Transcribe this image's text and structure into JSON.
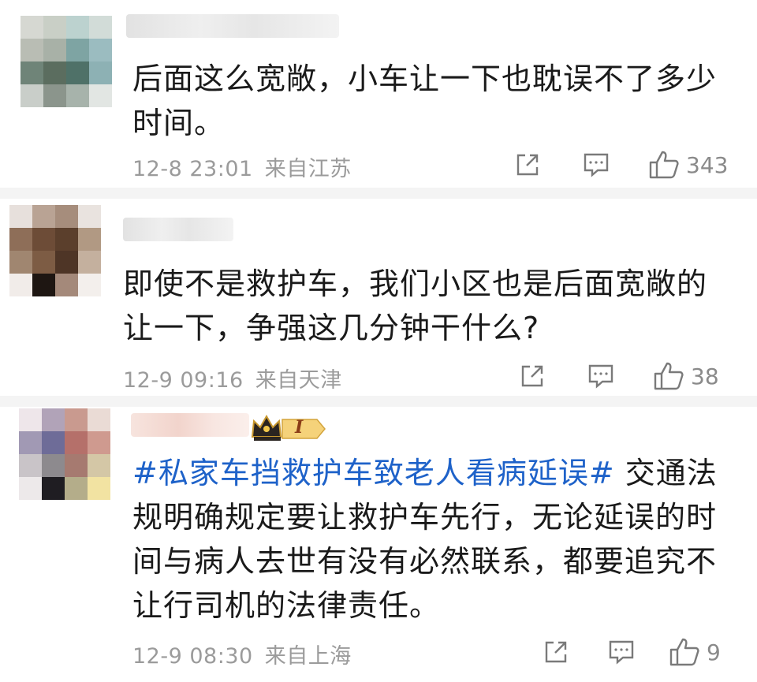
{
  "comments": [
    {
      "text": "后面这么宽敞，小车让一下也耽误不了多少时间。",
      "time": "12-8 23:01",
      "location": "来自江苏",
      "likes": "343"
    },
    {
      "text": "即使不是救护车，我们小区也是后面宽敞的让一下，争强这几分钟干什么?",
      "time": "12-9 09:16",
      "location": "来自天津",
      "likes": "38"
    },
    {
      "topic": "#私家车挡救护车致老人看病延误#",
      "text": " 交通法规明确规定要让救护车先行，无论延误的时间与病人去世有没有必然联系，都要追究不让行司机的法律责任。",
      "time": "12-9 08:30",
      "location": "来自上海",
      "likes": "9",
      "badge_label": "I"
    }
  ],
  "icons": {
    "share": "share-icon",
    "comment": "comment-icon",
    "like": "thumbs-up-icon",
    "badge": "crown-icon"
  },
  "colors": {
    "topic": "#1e62c9",
    "text": "#1a1a1a",
    "meta": "#9b9b9b",
    "separator": "#f4f4f4"
  }
}
